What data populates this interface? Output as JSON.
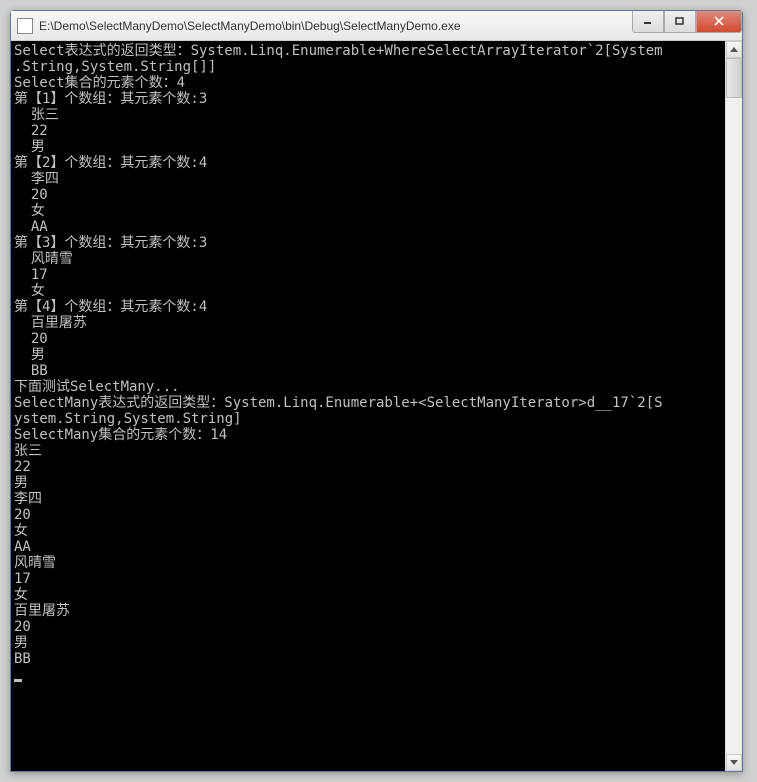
{
  "window": {
    "title": "E:\\Demo\\SelectManyDemo\\SelectManyDemo\\bin\\Debug\\SelectManyDemo.exe"
  },
  "console": {
    "lines": [
      "",
      "Select表达式的返回类型：System.Linq.Enumerable+WhereSelectArrayIterator`2[System",
      ".String,System.String[]]",
      "Select集合的元素个数：4",
      "第【1】个数组：其元素个数:3",
      "  张三",
      "  22",
      "  男",
      "第【2】个数组：其元素个数:4",
      "  李四",
      "  20",
      "  女",
      "  AA",
      "第【3】个数组：其元素个数:3",
      "  风晴雪",
      "  17",
      "  女",
      "第【4】个数组：其元素个数:4",
      "  百里屠苏",
      "  20",
      "  男",
      "  BB",
      "下面测试SelectMany...",
      "SelectMany表达式的返回类型：System.Linq.Enumerable+<SelectManyIterator>d__17`2[S",
      "ystem.String,System.String]",
      "SelectMany集合的元素个数：14",
      "张三",
      "22",
      "男",
      "李四",
      "20",
      "女",
      "AA",
      "风晴雪",
      "17",
      "女",
      "百里屠苏",
      "20",
      "男",
      "BB"
    ]
  }
}
